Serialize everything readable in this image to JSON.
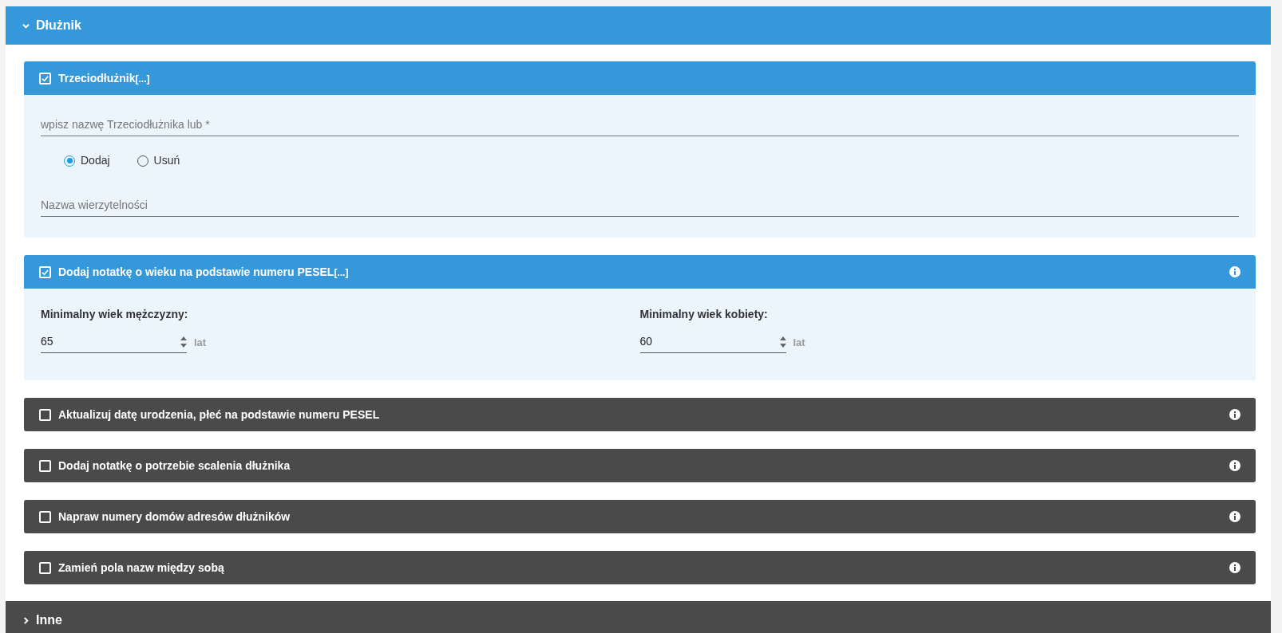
{
  "sections": [
    {
      "title": "Dłużnik",
      "expanded": true,
      "options": [
        {
          "kind": "fields",
          "label": "Trzeciodłużnik",
          "suffix": "[...]",
          "checked": true,
          "info": false,
          "name_field": {
            "placeholder": "wpisz nazwę Trzeciodłużnika lub *"
          },
          "radios": [
            {
              "label": "Dodaj",
              "selected": true
            },
            {
              "label": "Usuń",
              "selected": false
            }
          ],
          "claim_field": {
            "placeholder": "Nazwa wierzytelności"
          }
        },
        {
          "kind": "ages",
          "label": "Dodaj notatkę o wieku na podstawie numeru PESEL",
          "suffix": "[...]",
          "checked": true,
          "info": true,
          "ages": [
            {
              "label": "Minimalny wiek mężczyzny:",
              "value": "65",
              "unit": "lat"
            },
            {
              "label": "Minimalny wiek kobiety:",
              "value": "60",
              "unit": "lat"
            }
          ]
        },
        {
          "kind": "plain",
          "label": "Aktualizuj datę urodzenia, płeć na podstawie numeru PESEL",
          "checked": false,
          "info": true
        },
        {
          "kind": "plain",
          "label": "Dodaj notatkę o potrzebie scalenia dłużnika",
          "checked": false,
          "info": true
        },
        {
          "kind": "plain",
          "label": "Napraw numery domów adresów dłużników",
          "checked": false,
          "info": true
        },
        {
          "kind": "plain",
          "label": "Zamień pola nazw między sobą",
          "checked": false,
          "info": true
        }
      ]
    },
    {
      "title": "Inne",
      "expanded": false
    }
  ]
}
